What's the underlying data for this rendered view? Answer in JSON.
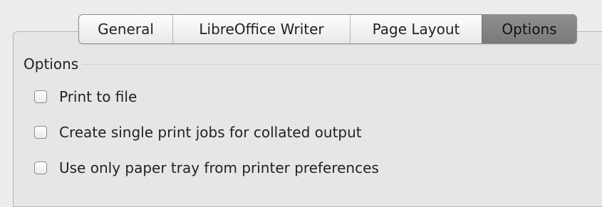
{
  "tabs": {
    "items": [
      {
        "label": "General",
        "selected": false
      },
      {
        "label": "LibreOffice Writer",
        "selected": false
      },
      {
        "label": "Page Layout",
        "selected": false
      },
      {
        "label": "Options",
        "selected": true
      }
    ]
  },
  "options_group": {
    "title": "Options",
    "checkboxes": [
      {
        "label": "Print to file",
        "checked": false
      },
      {
        "label": "Create single print jobs for collated output",
        "checked": false
      },
      {
        "label": "Use only paper tray from printer preferences",
        "checked": false
      }
    ]
  },
  "colors": {
    "window_background": "#ececec",
    "panel_background": "#e6e6e6",
    "selected_tab": "#828282"
  }
}
